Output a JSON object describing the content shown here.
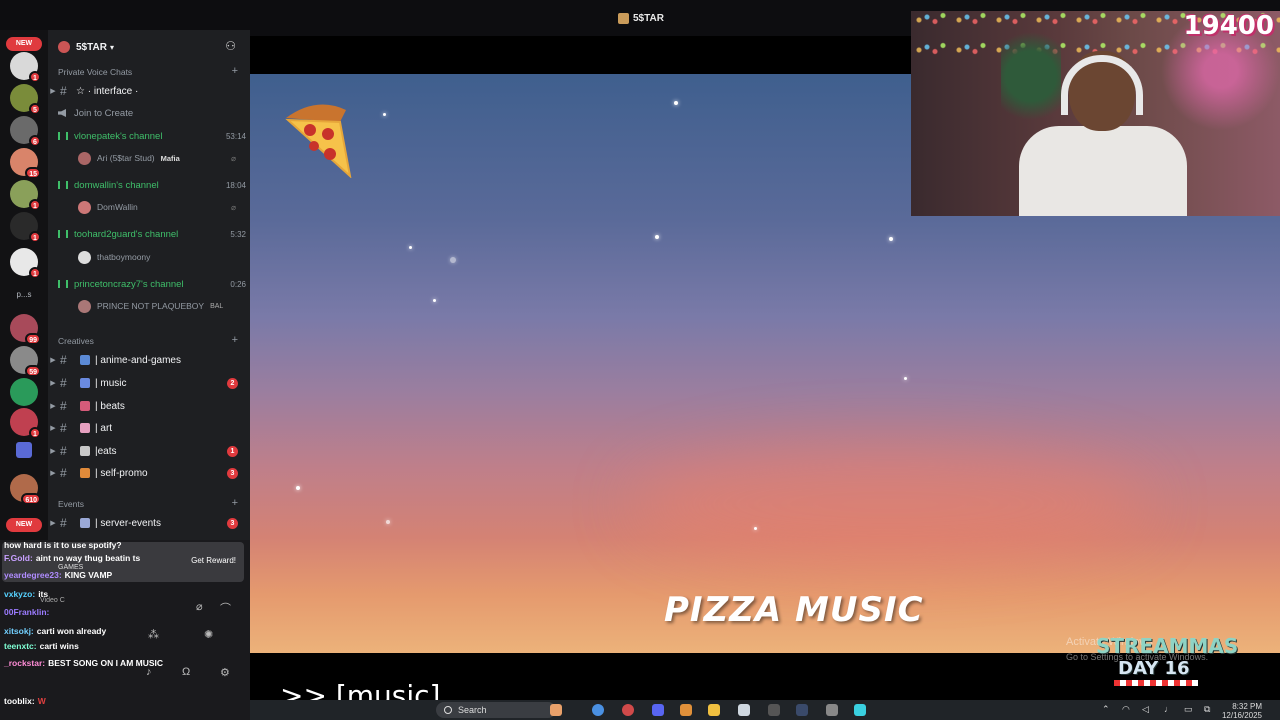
{
  "window": {
    "title": "5$TAR"
  },
  "rail": {
    "new_label": "NEW",
    "badges": [
      "1",
      "5",
      "6",
      "15",
      "1",
      "1",
      "1",
      "99",
      "59",
      "1",
      "1",
      "610"
    ],
    "text_server": "p...s",
    "bottom_new_label": "NEW"
  },
  "server": {
    "name": "5$TAR"
  },
  "categories": {
    "private": "Private Voice Chats",
    "creatives": "Creatives",
    "events": "Events"
  },
  "top_channel": {
    "label": "☆ · interface ·"
  },
  "join_label": "Join to Create",
  "voice_channels": [
    {
      "name": "vlonepatek's channel",
      "time": "53:14",
      "user": "Ari (5$tar Stud)",
      "user_tag": "Mafia"
    },
    {
      "name": "domwallin's channel",
      "time": "18:04",
      "user": "DomWallin"
    },
    {
      "name": "toohard2guard's channel",
      "time": "5:32",
      "user": "thatboymoony"
    },
    {
      "name": "princetoncrazy7's channel",
      "time": "0:26",
      "user": "PRINCE NOT PLAQUEBOY",
      "user_tag": "BAL"
    }
  ],
  "text_channels": [
    {
      "label": "| anime-and-games",
      "badge": ""
    },
    {
      "label": "| music",
      "badge": "2"
    },
    {
      "label": "| beats",
      "badge": ""
    },
    {
      "label": "| art",
      "badge": ""
    },
    {
      "label": "|eats",
      "badge": "1"
    },
    {
      "label": "| self-promo",
      "badge": "3"
    }
  ],
  "events_channel": {
    "label": "| server-events",
    "badge": "3"
  },
  "chat": {
    "reward_button": "Get Reward!",
    "games_label": "GAMES",
    "video_label": "Video C",
    "lines": [
      {
        "user": "how hard is it to use spotify?",
        "msg": "",
        "color": "#ffffff"
      },
      {
        "user": "F.Gold:",
        "msg": "aint no way thug beatin ts",
        "color": "#c8a0ff"
      },
      {
        "user": "yeardegree23:",
        "msg": "KING VAMP",
        "color": "#b08cff"
      },
      {
        "user": "vxkyzo:",
        "msg": "its",
        "color": "#56d2ff"
      },
      {
        "user": "00Franklin:",
        "msg": "",
        "color": "#9b7bff"
      },
      {
        "user": "xitsokj:",
        "msg": "carti won already",
        "color": "#72d0ff"
      },
      {
        "user": "teenxtc:",
        "msg": "carti wins",
        "color": "#7fffd4"
      },
      {
        "user": "_rockstar:",
        "msg": "BEST SONG ON I AM MUSIC",
        "color": "#ff8cd6"
      },
      {
        "user": "",
        "msg": "",
        "color": "#ff6aa2"
      },
      {
        "user": "tooblix:",
        "msg": "W",
        "color": "#ffffff"
      },
      {
        "user": "",
        "msg": "",
        "color": "#ff5a5a"
      }
    ]
  },
  "stage": {
    "title": "PIZZA MUSIC",
    "activate_line1": "Activate Windows",
    "activate_line2": "Go to Settings to activate Windows.",
    "series_title": "STREAMMAS",
    "series_day": "DAY 16"
  },
  "webcam": {
    "count": "19400"
  },
  "caption": {
    "text": ">> [music]"
  },
  "taskbar": {
    "search": "Search",
    "time": "8:32 PM",
    "date": "12/16/2025"
  }
}
